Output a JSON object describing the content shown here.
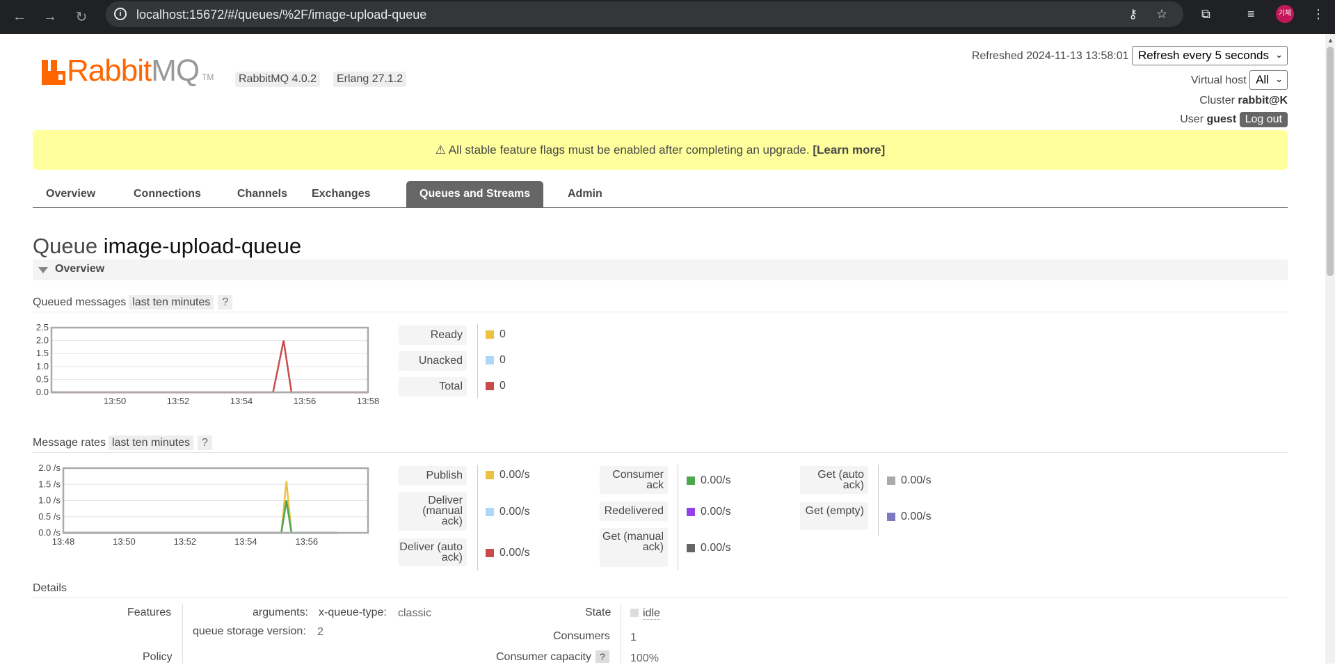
{
  "browser": {
    "url": "localhost:15672/#/queues/%2F/image-upload-queue",
    "avatar_text": "기체"
  },
  "header": {
    "logo_part1": "Rabbit",
    "logo_part2": "MQ",
    "logo_tm": "TM",
    "version": "RabbitMQ 4.0.2",
    "erlang": "Erlang 27.1.2",
    "refreshed_label": "Refreshed",
    "refreshed_time": "2024-11-13 13:58:01",
    "refresh_select": "Refresh every 5 seconds",
    "vhost_label": "Virtual host",
    "vhost_select": "All",
    "cluster_label": "Cluster",
    "cluster_value": "rabbit@K",
    "user_label": "User",
    "user_value": "guest",
    "logout": "Log out"
  },
  "banner": {
    "icon": "⚠",
    "text": "All stable feature flags must be enabled after completing an upgrade.",
    "link": "[Learn more]"
  },
  "tabs": [
    "Overview",
    "Connections",
    "Channels",
    "Exchanges",
    "Queues and Streams",
    "Admin"
  ],
  "page": {
    "title_prefix": "Queue",
    "title_name": "image-upload-queue",
    "section": "Overview"
  },
  "queued": {
    "label": "Queued messages",
    "range": "last ten minutes",
    "help": "?",
    "legend": [
      {
        "name": "Ready",
        "value": "0",
        "color": "#edc240"
      },
      {
        "name": "Unacked",
        "value": "0",
        "color": "#afd8f8"
      },
      {
        "name": "Total",
        "value": "0",
        "color": "#cb4b4b"
      }
    ]
  },
  "rates": {
    "label": "Message rates",
    "range": "last ten minutes",
    "help": "?",
    "col1": [
      {
        "name": "Publish",
        "value": "0.00/s",
        "color": "#edc240"
      },
      {
        "name": "Deliver (manual ack)",
        "value": "0.00/s",
        "color": "#afd8f8"
      },
      {
        "name": "Deliver (auto ack)",
        "value": "0.00/s",
        "color": "#cb4b4b"
      }
    ],
    "col2": [
      {
        "name": "Consumer ack",
        "value": "0.00/s",
        "color": "#4da74d"
      },
      {
        "name": "Redelivered",
        "value": "0.00/s",
        "color": "#9440ed"
      },
      {
        "name": "Get (manual ack)",
        "value": "0.00/s",
        "color": "#666666"
      }
    ],
    "col3": [
      {
        "name": "Get (auto ack)",
        "value": "0.00/s",
        "color": "#aaaaaa"
      },
      {
        "name": "Get (empty)",
        "value": "0.00/s",
        "color": "#7c79c3"
      }
    ]
  },
  "details": {
    "heading": "Details",
    "features_label": "Features",
    "arguments_label": "arguments:",
    "arg_key": "x-queue-type:",
    "arg_value": "classic",
    "storage_label": "queue storage version:",
    "storage_value": "2",
    "policy_label": "Policy",
    "state_label": "State",
    "state_value": "idle",
    "consumers_label": "Consumers",
    "consumers_value": "1",
    "capacity_label": "Consumer capacity",
    "capacity_help": "?",
    "capacity_value": "100%"
  },
  "chart_data": [
    {
      "type": "line",
      "x": [
        "13:48",
        "13:49",
        "13:50",
        "13:51",
        "13:52",
        "13:53",
        "13:54",
        "13:55",
        "13:55:20",
        "13:55:35",
        "13:56",
        "13:57",
        "13:58"
      ],
      "series": [
        {
          "name": "Ready",
          "values": [
            0,
            0,
            0,
            0,
            0,
            0,
            0,
            0,
            0,
            0,
            0,
            0,
            0
          ]
        },
        {
          "name": "Unacked",
          "values": [
            0,
            0,
            0,
            0,
            0,
            0,
            0,
            0,
            0,
            0,
            0,
            0,
            0
          ]
        },
        {
          "name": "Total",
          "values": [
            0,
            0,
            0,
            0,
            0,
            0,
            0,
            0,
            2,
            0,
            0,
            0,
            0
          ]
        }
      ],
      "xticks": [
        "13:50",
        "13:52",
        "13:54",
        "13:56",
        "13:58"
      ],
      "yticks": [
        "0.0",
        "0.5",
        "1.0",
        "1.5",
        "2.0",
        "2.5"
      ],
      "ylim": [
        0,
        2.5
      ]
    },
    {
      "type": "line",
      "x": [
        "13:48",
        "13:50",
        "13:52",
        "13:54",
        "13:55:10",
        "13:55:20",
        "13:55:30",
        "13:56",
        "13:57"
      ],
      "series": [
        {
          "name": "Publish",
          "values": [
            0,
            0,
            0,
            0,
            0,
            1.6,
            0,
            0,
            0
          ]
        },
        {
          "name": "Deliver (manual ack)",
          "values": [
            0,
            0,
            0,
            0,
            0,
            1.0,
            0,
            0,
            0
          ]
        },
        {
          "name": "Consumer ack",
          "values": [
            0,
            0,
            0,
            0,
            0,
            1.0,
            0,
            0,
            0
          ]
        },
        {
          "name": "Get (empty)",
          "values": [
            0,
            0,
            0,
            0,
            0,
            0,
            0,
            0,
            0
          ]
        }
      ],
      "xticks": [
        "13:48",
        "13:50",
        "13:52",
        "13:54",
        "13:56"
      ],
      "yticks": [
        "0.0 /s",
        "0.5 /s",
        "1.0 /s",
        "1.5 /s",
        "2.0 /s"
      ],
      "ylim": [
        0,
        2.0
      ]
    }
  ]
}
